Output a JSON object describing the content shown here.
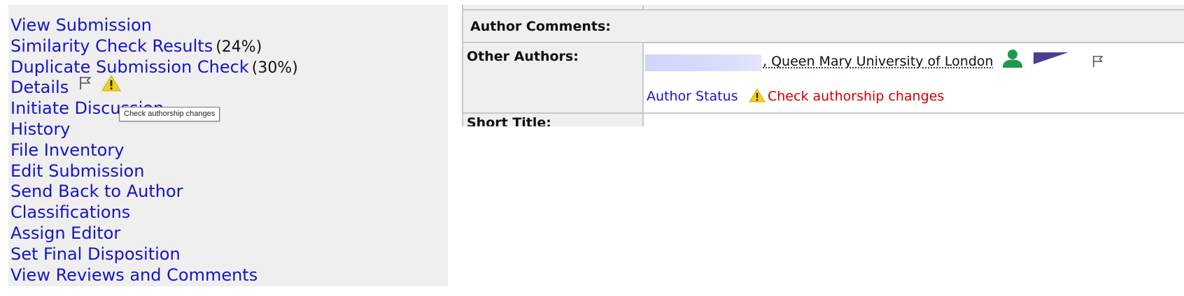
{
  "actions": {
    "view_submission": "View Submission",
    "similarity_check": "Similarity Check Results",
    "similarity_pct": "(24%)",
    "duplicate_check": "Duplicate Submission Check",
    "duplicate_pct": "(30%)",
    "details": "Details",
    "initiate_discussion": "Initiate Discussion",
    "history": "History",
    "file_inventory": "File Inventory",
    "edit_submission": "Edit Submission",
    "send_back": "Send Back to Author",
    "classifications": "Classifications",
    "assign_editor": "Assign Editor",
    "set_final_disposition": "Set Final Disposition",
    "view_reviews": "View Reviews and Comments"
  },
  "tooltip": {
    "text": "Check authorship changes"
  },
  "details_table": {
    "author_comments_label": "Author Comments:",
    "other_authors_label": "Other Authors:",
    "affiliation": ", Queen Mary University of London",
    "author_status_label": "Author Status",
    "author_status_message": "Check authorship changes",
    "short_title_label": "Short Title:"
  },
  "icons": {
    "details_flag": "flag-outline-icon",
    "details_warning": "warning-icon",
    "author_person": "person-icon",
    "author_flag": "flag-outline-icon",
    "status_warning": "warning-icon"
  },
  "colors": {
    "link": "#1515c4",
    "warning_text": "#cc0000",
    "warning_icon": "#f2d21b",
    "person_icon": "#1a9a4b",
    "panel_bg": "#efefef",
    "pennant": "#4a3f8f"
  }
}
